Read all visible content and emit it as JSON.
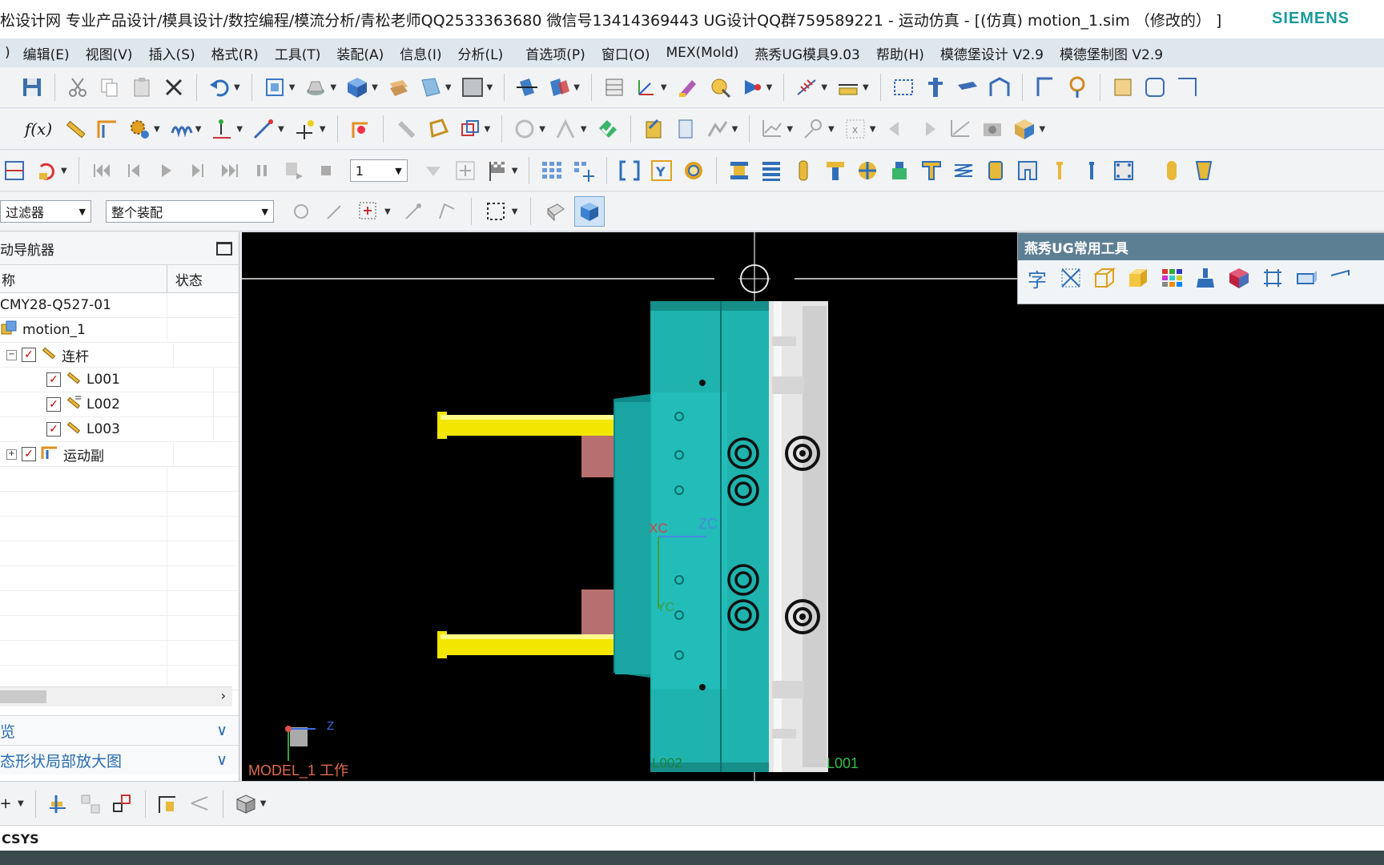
{
  "window": {
    "title": "松设计网 专业产品设计/模具设计/数控编程/模流分析/青松老师QQ2533363680 微信号13414369443 UG设计QQ群759589221 - 运动仿真 - [(仿真) motion_1.sim （修改的） ]",
    "brand": "SIEMENS"
  },
  "menu": {
    "items": [
      "编辑(E)",
      "视图(V)",
      "插入(S)",
      "格式(R)",
      "工具(T)",
      "装配(A)",
      "信息(I)",
      "分析(L)",
      "首选项(P)",
      "窗口(O)",
      "MEX(Mold)",
      "燕秀UG模具9.03",
      "帮助(H)",
      "模德堡设计 V2.9",
      "模德堡制图 V2.9"
    ]
  },
  "toolbar3": {
    "frame_value": "1"
  },
  "filters": {
    "type_filter": "过滤器",
    "scope_filter": "整个装配"
  },
  "navigator": {
    "title": "动导航器",
    "col_name": "称",
    "col_status": "状态",
    "root": "CMY28-Q527-01",
    "model": "motion_1",
    "links_group": "连杆",
    "links": [
      "L001",
      "L002",
      "L003"
    ],
    "joints_group": "运动副",
    "accordion1": "览",
    "accordion2": "态形状局部放大图"
  },
  "float_panel": {
    "title": "燕秀UG常用工具",
    "first_icon_char": "字"
  },
  "viewport": {
    "axis_xc": "XC",
    "axis_zc": "ZC",
    "axis_yc": "YC",
    "triad_z": "Z",
    "work_label": "MODEL_1 工作",
    "part_label_left": "L002",
    "part_label_right": "L001",
    "colors": {
      "teal": "#1fa7a3",
      "yellow": "#f2e600",
      "white_part": "#e8e8e8",
      "label_red": "#e06a50"
    }
  },
  "status": {
    "text": "CSYS"
  }
}
